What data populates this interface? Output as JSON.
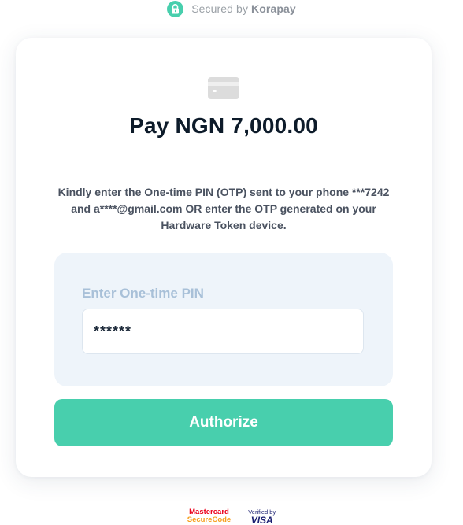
{
  "header": {
    "secured_prefix": "Secured by ",
    "brand": "Korapay",
    "lock_icon": "lock-icon",
    "accent_color": "#48cfad"
  },
  "card": {
    "icon": "credit-card-icon",
    "pay_amount": "Pay NGN 7,000.00",
    "instruction": "Kindly enter the One-time PIN (OTP) sent to your phone ***7242 and a****@gmail.com OR enter the OTP generated on your Hardware Token device.",
    "pin_label": "Enter One-time PIN",
    "pin_value": "******",
    "authorize_label": "Authorize"
  },
  "footer": {
    "mastercard_line1": "Mastercard",
    "mastercard_line2": "SecureCode",
    "visa_line1": "Verified by",
    "visa_line2": "VISA"
  }
}
